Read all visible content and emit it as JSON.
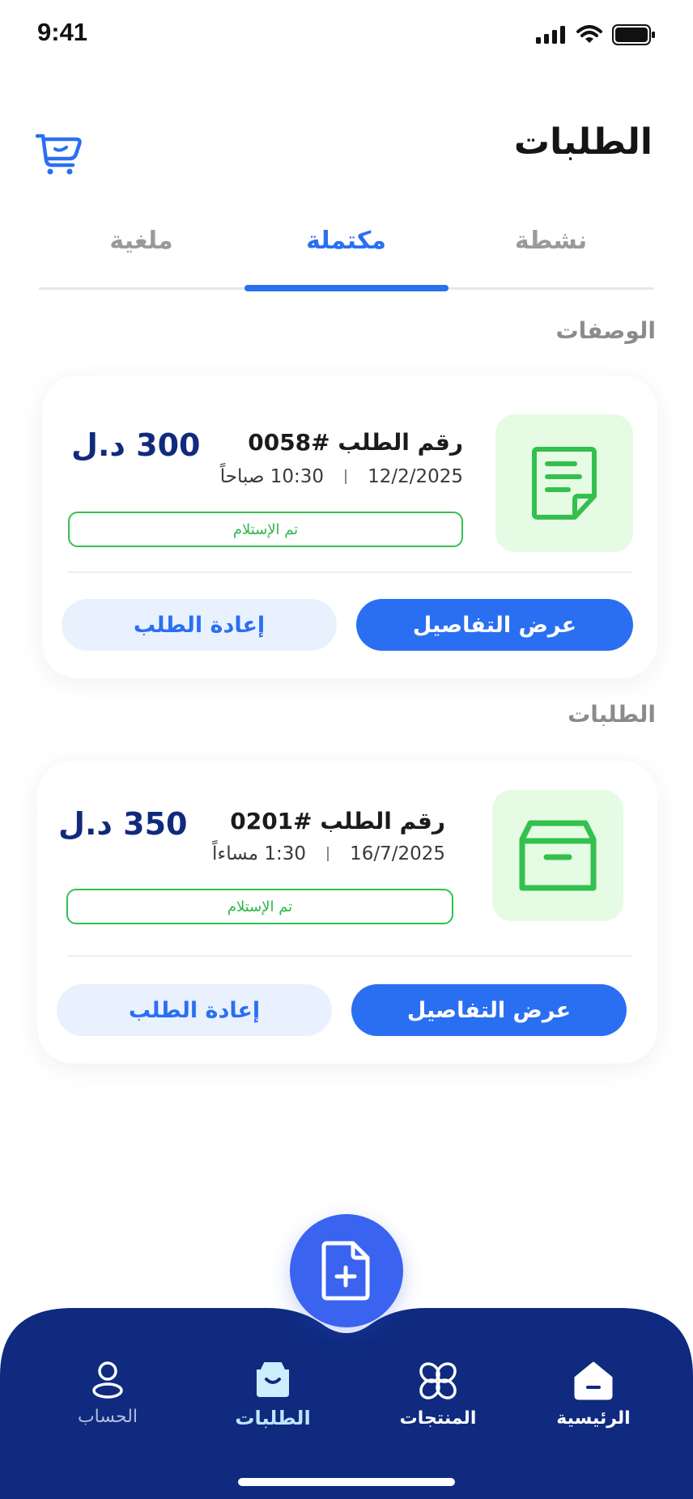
{
  "status_bar": {
    "time": "9:41"
  },
  "header": {
    "title": "الطلبات",
    "cart_icon": "cart-icon"
  },
  "tabs": [
    {
      "label": "نشطة",
      "selected": false
    },
    {
      "label": "مكتملة",
      "selected": true
    },
    {
      "label": "ملغية",
      "selected": false
    }
  ],
  "sections": {
    "prescriptions": "الوصفات",
    "orders": "الطلبات"
  },
  "cards": [
    {
      "icon": "document-icon",
      "order_number": "رقم الطلب #0058",
      "date": "12/2/2025",
      "time": "10:30 صباحاً",
      "price": "300 د.ل",
      "status": "تم الإستلام",
      "details_label": "عرض التفاصيل",
      "reorder_label": "إعادة الطلب"
    },
    {
      "icon": "box-icon",
      "order_number": "رقم الطلب #0201",
      "date": "16/7/2025",
      "time": "1:30 مساءاً",
      "price": "350 د.ل",
      "status": "تم الإستلام",
      "details_label": "عرض التفاصيل",
      "reorder_label": "إعادة الطلب"
    }
  ],
  "fab": {
    "icon": "add-file-icon"
  },
  "bottom_nav": {
    "items": [
      {
        "label": "الرئيسية",
        "icon": "home-icon"
      },
      {
        "label": "المنتجات",
        "icon": "products-icon"
      },
      {
        "label": "الطلبات",
        "icon": "orders-bag-icon",
        "selected": true
      },
      {
        "label": "الحساب",
        "icon": "user-icon"
      }
    ]
  },
  "colors": {
    "accent": "#2a6ff2",
    "nav_background": "#0f2a7f",
    "status_green": "#33c04f",
    "price_navy": "#112a7c"
  }
}
